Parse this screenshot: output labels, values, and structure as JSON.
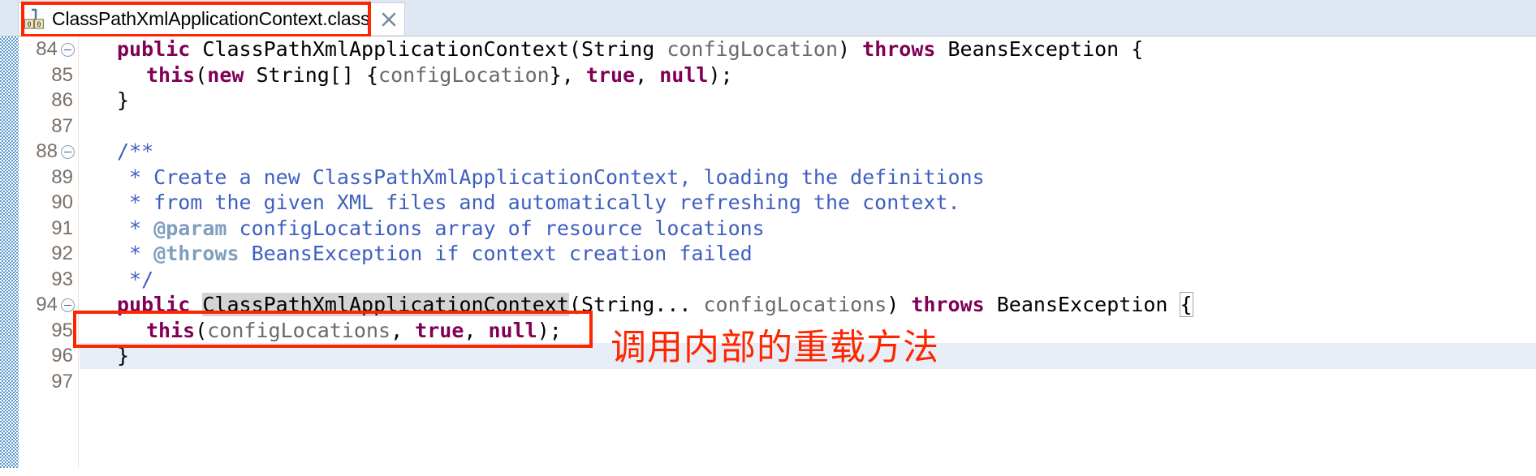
{
  "window": {
    "tab": {
      "label": "ClassPathXmlApplicationContext.class",
      "icon": "java-class-file-icon",
      "close_icon": "close-icon",
      "highlighted": true
    }
  },
  "editor": {
    "gutter_lines": [
      {
        "number": "84",
        "fold": true
      },
      {
        "number": "85",
        "fold": false
      },
      {
        "number": "86",
        "fold": false
      },
      {
        "number": "87",
        "fold": false
      },
      {
        "number": "88",
        "fold": true
      },
      {
        "number": "89",
        "fold": false
      },
      {
        "number": "90",
        "fold": false
      },
      {
        "number": "91",
        "fold": false
      },
      {
        "number": "92",
        "fold": false
      },
      {
        "number": "93",
        "fold": false
      },
      {
        "number": "94",
        "fold": true
      },
      {
        "number": "95",
        "fold": false
      },
      {
        "number": "96",
        "fold": false
      },
      {
        "number": "97",
        "fold": false
      }
    ],
    "lines": [
      {
        "n": "84",
        "tokens": [
          {
            "t": "public",
            "c": "kw"
          },
          {
            "t": " ClassPathXmlApplicationContext(String ",
            "c": "typ"
          },
          {
            "t": "configLocation",
            "c": "par"
          },
          {
            "t": ") ",
            "c": "typ"
          },
          {
            "t": "throws",
            "c": "kw"
          },
          {
            "t": " BeansException {",
            "c": "typ"
          }
        ]
      },
      {
        "n": "85",
        "indent": 1,
        "tokens": [
          {
            "t": "this",
            "c": "kw"
          },
          {
            "t": "(",
            "c": "typ"
          },
          {
            "t": "new",
            "c": "kw"
          },
          {
            "t": " String[] {",
            "c": "typ"
          },
          {
            "t": "configLocation",
            "c": "par"
          },
          {
            "t": "}, ",
            "c": "typ"
          },
          {
            "t": "true",
            "c": "kw"
          },
          {
            "t": ", ",
            "c": "typ"
          },
          {
            "t": "null",
            "c": "kw"
          },
          {
            "t": ");",
            "c": "typ"
          }
        ]
      },
      {
        "n": "86",
        "tokens": [
          {
            "t": "}",
            "c": "typ"
          }
        ]
      },
      {
        "n": "87",
        "tokens": [
          {
            "t": "",
            "c": "typ"
          }
        ]
      },
      {
        "n": "88",
        "tokens": [
          {
            "t": "/**",
            "c": "cm"
          }
        ]
      },
      {
        "n": "89",
        "tokens": [
          {
            "t": " * Create a new ClassPathXmlApplicationContext, loading the definitions",
            "c": "cm"
          }
        ]
      },
      {
        "n": "90",
        "tokens": [
          {
            "t": " * from the given XML files and automatically refreshing the context.",
            "c": "cm"
          }
        ]
      },
      {
        "n": "91",
        "tokens": [
          {
            "t": " * ",
            "c": "cm"
          },
          {
            "t": "@param",
            "c": "cmt"
          },
          {
            "t": " configLocations array of resource locations",
            "c": "cm"
          }
        ]
      },
      {
        "n": "92",
        "tokens": [
          {
            "t": " * ",
            "c": "cm"
          },
          {
            "t": "@throws",
            "c": "cmt"
          },
          {
            "t": " BeansException if context creation failed",
            "c": "cm"
          }
        ]
      },
      {
        "n": "93",
        "tokens": [
          {
            "t": " */",
            "c": "cm"
          }
        ]
      },
      {
        "n": "94",
        "tokens": [
          {
            "t": "public",
            "c": "kw"
          },
          {
            "t": " ",
            "c": "typ"
          },
          {
            "t": "ClassPathXmlApplicationContext",
            "c": "typ occ"
          },
          {
            "t": "(String... ",
            "c": "typ"
          },
          {
            "t": "configLocations",
            "c": "par"
          },
          {
            "t": ") ",
            "c": "typ"
          },
          {
            "t": "throws",
            "c": "kw"
          },
          {
            "t": " BeansException ",
            "c": "typ"
          },
          {
            "t": "{",
            "c": "typ brk"
          }
        ]
      },
      {
        "n": "95",
        "indent": 1,
        "tokens": [
          {
            "t": "this",
            "c": "kw"
          },
          {
            "t": "(",
            "c": "typ"
          },
          {
            "t": "configLocations",
            "c": "par"
          },
          {
            "t": ", ",
            "c": "typ"
          },
          {
            "t": "true",
            "c": "kw"
          },
          {
            "t": ", ",
            "c": "typ"
          },
          {
            "t": "null",
            "c": "kw"
          },
          {
            "t": ");",
            "c": "typ"
          }
        ]
      },
      {
        "n": "96",
        "current": true,
        "tokens": [
          {
            "t": "}",
            "c": "typ"
          }
        ]
      },
      {
        "n": "97",
        "tokens": [
          {
            "t": "",
            "c": "typ"
          }
        ]
      }
    ]
  },
  "annotations": {
    "tab_box": {
      "name": "tab-highlight-box"
    },
    "code_box": {
      "name": "this-call-highlight-box"
    },
    "note": "调用内部的重载方法"
  },
  "colors": {
    "annotation_red": "#fe2600",
    "keyword": "#7f0055",
    "comment": "#3f5fbf",
    "comment_tag": "#7f9fbf",
    "parameter": "#6a6a6a",
    "occurrence_highlight": "#d4d4d4",
    "current_line": "#e8eef7",
    "tabbar_bg": "#dfe8f2"
  }
}
